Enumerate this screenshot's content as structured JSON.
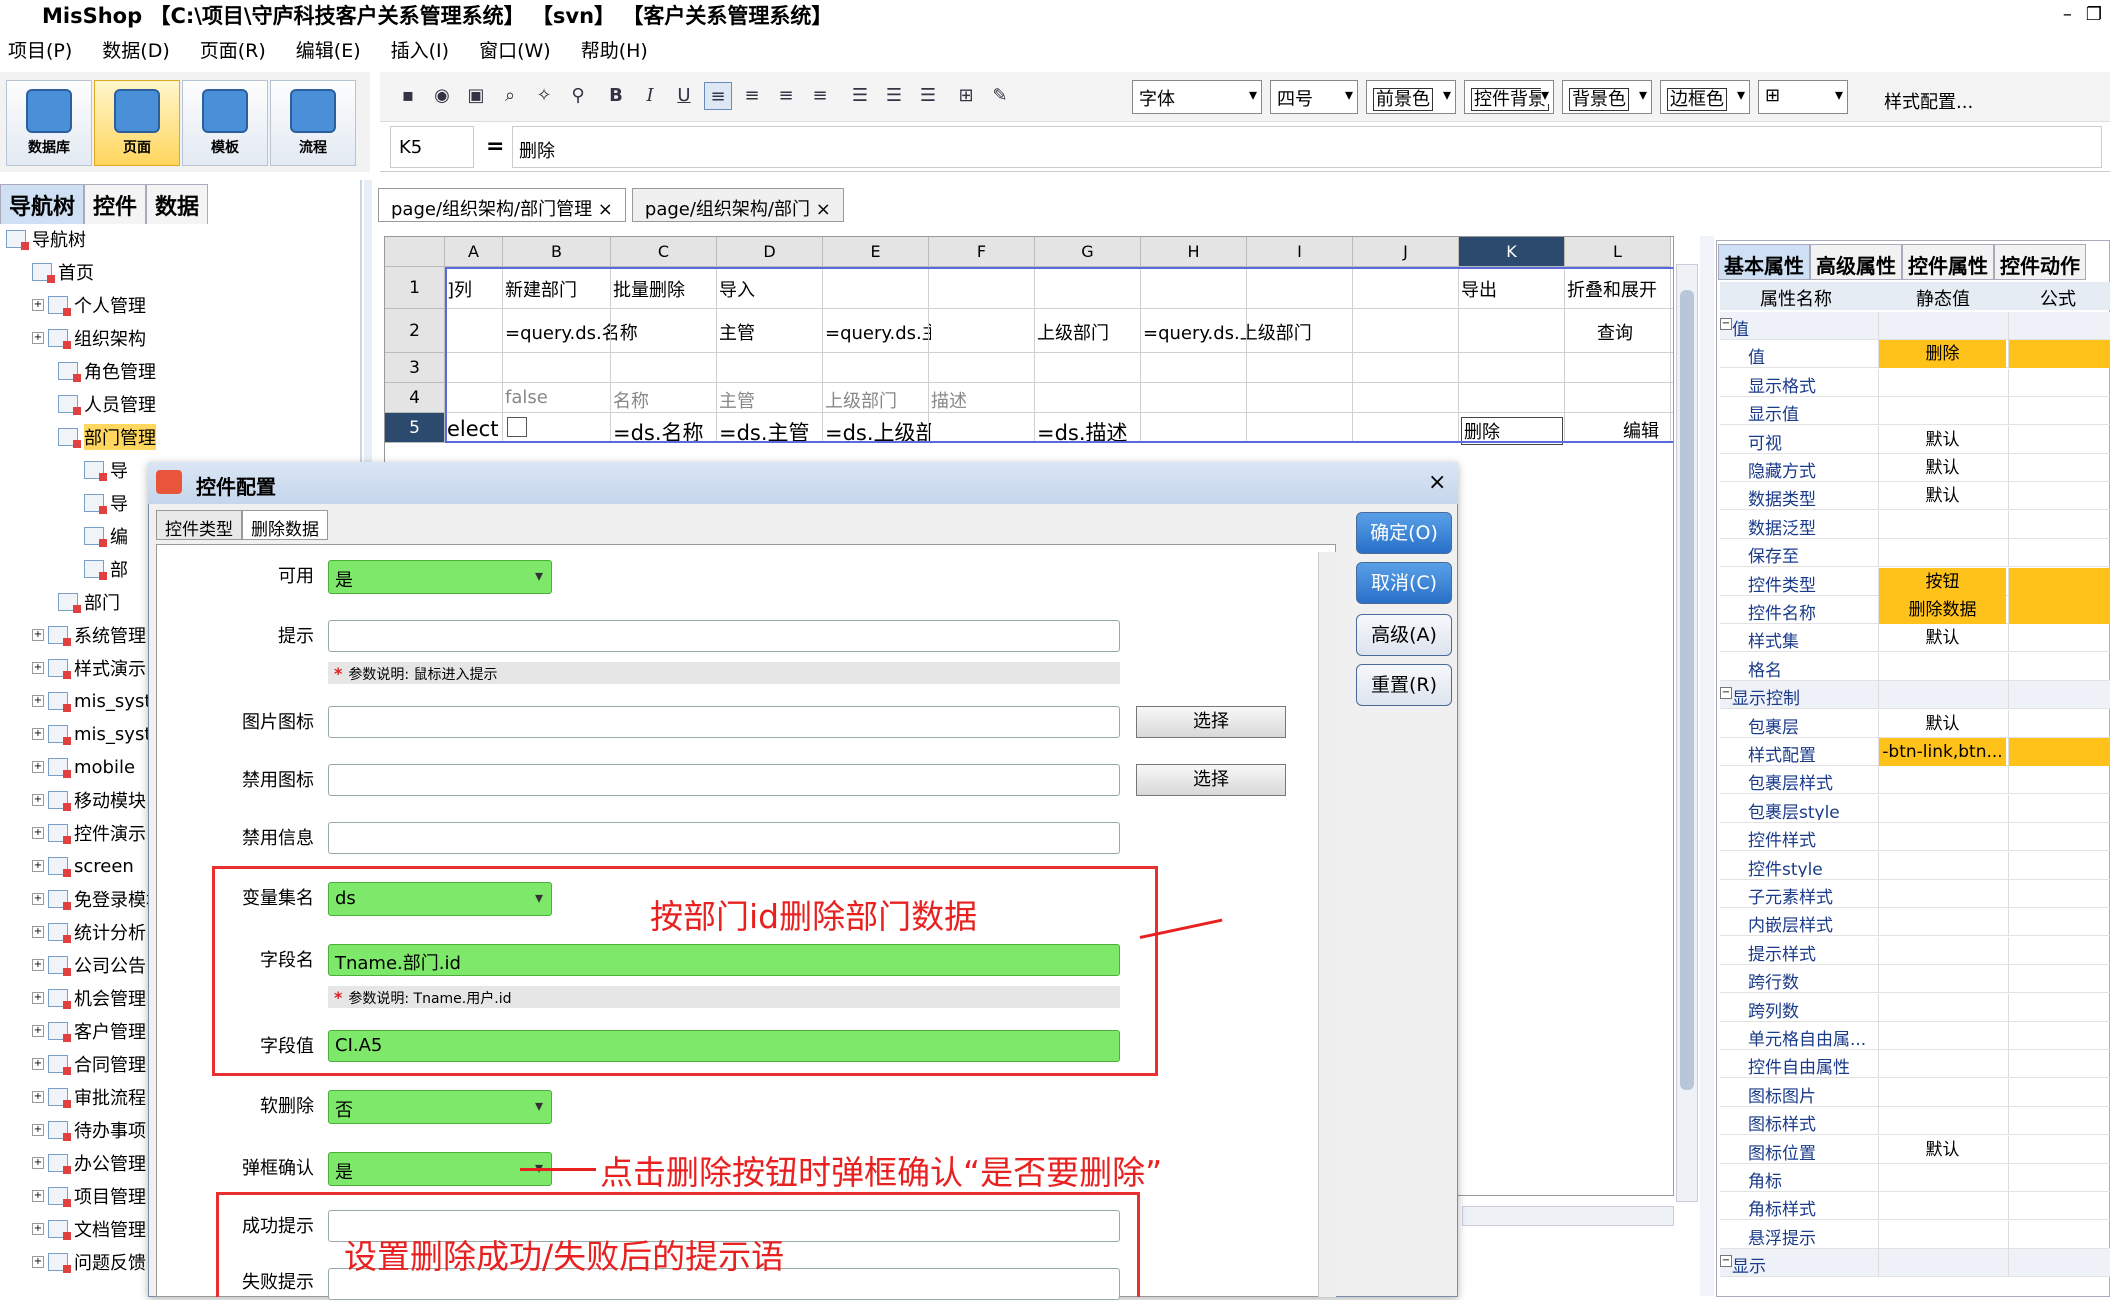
{
  "app": {
    "title": "MisShop 【C:\\项目\\守庐科技客户关系管理系统】 【svn】 【客户关系管理系统】",
    "win_min": "–",
    "win_restore": "❐"
  },
  "menu": [
    "项目(P)",
    "数据(D)",
    "页面(R)",
    "编辑(E)",
    "插入(I)",
    "窗口(W)",
    "帮助(H)"
  ],
  "big_tools": [
    "数据库",
    "页面",
    "模板",
    "流程"
  ],
  "toolbar": {
    "bold": "B",
    "italic": "I",
    "underline": "U",
    "font": "字体",
    "size": "四号",
    "fg": "前景色",
    "ctrl_bg": "控件背景",
    "bg": "背景色",
    "border": "边框色",
    "style_config": "样式配置..."
  },
  "formula": {
    "cell_ref": "K5",
    "eq": "=",
    "value": "删除"
  },
  "left_tabs": [
    "导航树",
    "控件",
    "数据"
  ],
  "tree": [
    {
      "label": "导航树",
      "indent": 0
    },
    {
      "label": "首页",
      "indent": 1
    },
    {
      "label": "个人管理",
      "indent": 1
    },
    {
      "label": "组织架构",
      "indent": 1
    },
    {
      "label": "角色管理",
      "indent": 2
    },
    {
      "label": "人员管理",
      "indent": 2
    },
    {
      "label": "部门管理",
      "indent": 2,
      "selected": true
    },
    {
      "label": "导",
      "indent": 3
    },
    {
      "label": "导",
      "indent": 3
    },
    {
      "label": "编",
      "indent": 3
    },
    {
      "label": "部",
      "indent": 3
    },
    {
      "label": "部门",
      "indent": 2
    },
    {
      "label": "系统管理",
      "indent": 1
    },
    {
      "label": "样式演示",
      "indent": 1
    },
    {
      "label": "mis_syster",
      "indent": 1
    },
    {
      "label": "mis_syster",
      "indent": 1
    },
    {
      "label": "mobile",
      "indent": 1
    },
    {
      "label": "移动模块",
      "indent": 1
    },
    {
      "label": "控件演示",
      "indent": 1
    },
    {
      "label": "screen",
      "indent": 1
    },
    {
      "label": "免登录模块",
      "indent": 1
    },
    {
      "label": "统计分析",
      "indent": 1
    },
    {
      "label": "公司公告",
      "indent": 1
    },
    {
      "label": "机会管理",
      "indent": 1
    },
    {
      "label": "客户管理",
      "indent": 1
    },
    {
      "label": "合同管理",
      "indent": 1
    },
    {
      "label": "审批流程",
      "indent": 1
    },
    {
      "label": "待办事项",
      "indent": 1
    },
    {
      "label": "办公管理",
      "indent": 1
    },
    {
      "label": "项目管理",
      "indent": 1
    },
    {
      "label": "文档管理",
      "indent": 1
    },
    {
      "label": "问题反馈",
      "indent": 1
    }
  ],
  "doc_tabs": [
    {
      "label": "page/组织架构/部门管理 ×",
      "active": true
    },
    {
      "label": "page/组织架构/部门 ×",
      "active": false
    }
  ],
  "sheet": {
    "columns": [
      "A",
      "B",
      "C",
      "D",
      "E",
      "F",
      "G",
      "H",
      "I",
      "J",
      "K",
      "L"
    ],
    "rows": [
      "1",
      "2",
      "3",
      "4",
      "5"
    ],
    "cells": {
      "r1": {
        "a": "]列",
        "b": "新建部门",
        "c": "批量删除",
        "d": "导入",
        "k": "导出",
        "l": "折叠和展开"
      },
      "r2": {
        "b": "=query.ds.名称",
        "d": "主管",
        "e": "=query.ds.主管",
        "g": "上级部门",
        "h": "=query.ds.上级部门",
        "l": "查询"
      },
      "r4": {
        "b": "false",
        "c": "名称",
        "d": "主管",
        "e": "上级部门",
        "f": "描述"
      },
      "r5": {
        "a": "elect",
        "c": "=ds.名称",
        "d": "=ds.主管",
        "e": "=ds.上级部",
        "g": "=ds.描述",
        "k": "删除",
        "l": "编辑"
      }
    }
  },
  "props": {
    "tabs": [
      "基本属性",
      "高级属性",
      "控件属性",
      "控件动作"
    ],
    "headers": [
      "属性名称",
      "静态值",
      "公式"
    ],
    "rows": [
      {
        "name": "值",
        "group": true
      },
      {
        "name": "值",
        "value": "删除",
        "hl": true
      },
      {
        "name": "显示格式"
      },
      {
        "name": "显示值"
      },
      {
        "name": "可视",
        "value": "默认"
      },
      {
        "name": "隐藏方式",
        "value": "默认"
      },
      {
        "name": "数据类型",
        "value": "默认"
      },
      {
        "name": "数据泛型"
      },
      {
        "name": "保存至"
      },
      {
        "name": "控件类型",
        "value": "按钮",
        "hl": true
      },
      {
        "name": "控件名称",
        "value": "删除数据",
        "hl": true
      },
      {
        "name": "样式集",
        "value": "默认"
      },
      {
        "name": "格名"
      },
      {
        "name": "显示控制",
        "group": true
      },
      {
        "name": "包裹层",
        "value": "默认"
      },
      {
        "name": "样式配置",
        "value": "-btn-link,btn...",
        "hl": true
      },
      {
        "name": "包裹层样式"
      },
      {
        "name": "包裹层style"
      },
      {
        "name": "控件样式"
      },
      {
        "name": "控件style"
      },
      {
        "name": "子元素样式"
      },
      {
        "name": "内嵌层样式"
      },
      {
        "name": "提示样式"
      },
      {
        "name": "跨行数"
      },
      {
        "name": "跨列数"
      },
      {
        "name": "单元格自由属..."
      },
      {
        "name": "控件自由属性"
      },
      {
        "name": "图标图片"
      },
      {
        "name": "图标样式"
      },
      {
        "name": "图标位置",
        "value": "默认"
      },
      {
        "name": "角标"
      },
      {
        "name": "角标样式"
      },
      {
        "name": "悬浮提示"
      },
      {
        "name": "显示",
        "group": true
      }
    ]
  },
  "dialog": {
    "title": "控件配置",
    "close": "×",
    "tabs": [
      "控件类型",
      "删除数据"
    ],
    "buttons": [
      "确定(O)",
      "取消(C)",
      "高级(A)",
      "重置(R)"
    ],
    "fields": {
      "enabled_label": "可用",
      "enabled_value": "是",
      "tip_label": "提示",
      "tip_hint_mark": "*",
      "tip_hint": "参数说明: 鼠标进入提示",
      "img_label": "图片图标",
      "img_button": "选择",
      "disabled_img_label": "禁用图标",
      "disabled_img_button": "选择",
      "disabled_msg_label": "禁用信息",
      "varset_label": "变量集名",
      "varset_value": "ds",
      "field_label": "字段名",
      "field_value": "Tname.部门.id",
      "field_hint_mark": "*",
      "field_hint": "参数说明: Tname.用户.id",
      "fieldval_label": "字段值",
      "fieldval_value": "CI.A5",
      "soft_label": "软删除",
      "soft_value": "否",
      "confirm_label": "弹框确认",
      "confirm_value": "是",
      "success_label": "成功提示",
      "fail_label": "失败提示"
    }
  },
  "annotations": {
    "a1": "按部门id删除部门数据",
    "a2": "点击删除按钮时弹框确认“是否要删除”",
    "a3": "设置删除成功/失败后的提示语"
  },
  "colors": {
    "accent": "#ffc21a",
    "green": "#7ee86a",
    "red": "#e82020",
    "select": "#2c4a6e"
  }
}
